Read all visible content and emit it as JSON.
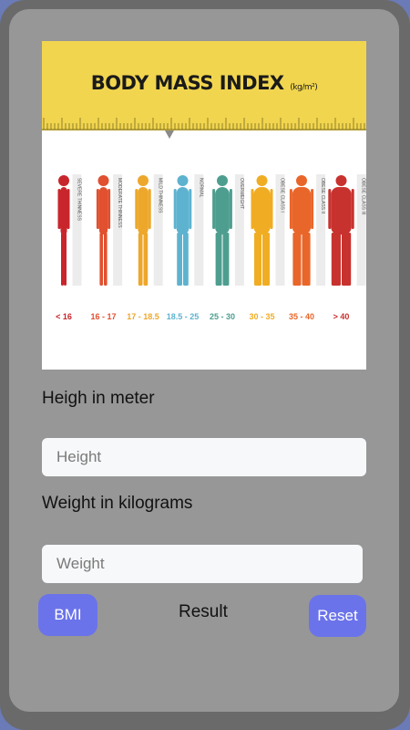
{
  "banner": {
    "title": "BODY MASS INDEX",
    "unit": "(kg/m²)",
    "categories": [
      {
        "label": "SEVERE THINNESS",
        "range": "< 16",
        "color": "#c8262c"
      },
      {
        "label": "MODERATE THINNESS",
        "range": "16 - 17",
        "color": "#e1502f"
      },
      {
        "label": "MILD THINNESS",
        "range": "17 - 18.5",
        "color": "#eda72b"
      },
      {
        "label": "NORMAL",
        "range": "18.5 - 25",
        "color": "#5db3cf"
      },
      {
        "label": "OVERWEIGHT",
        "range": "25 - 30",
        "color": "#4e9e8f"
      },
      {
        "label": "OBESE CLASS I",
        "range": "30 - 35",
        "color": "#f0ad23"
      },
      {
        "label": "OBESE CLASS II",
        "range": "35 - 40",
        "color": "#e9662a"
      },
      {
        "label": "OBESE CLASS III",
        "range": "> 40",
        "color": "#c8322e"
      }
    ]
  },
  "form": {
    "height_label": "Heigh in meter",
    "height_placeholder": "Height",
    "weight_label": "Weight in kilograms",
    "weight_placeholder": "Weight"
  },
  "actions": {
    "bmi_label": "BMI",
    "result_label": "Result",
    "reset_label": "Reset"
  }
}
